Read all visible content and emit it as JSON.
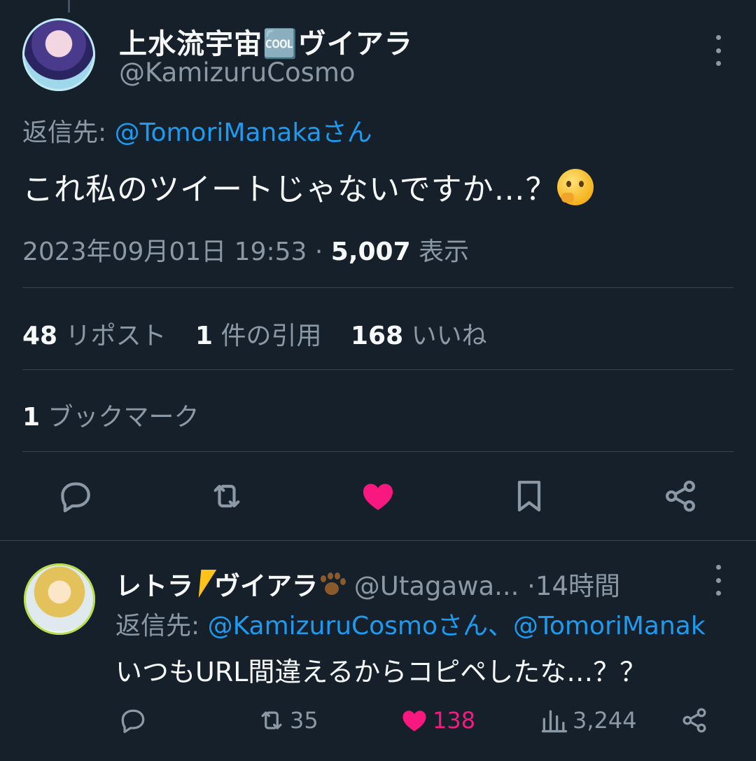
{
  "main_tweet": {
    "display_name": "上水流宇宙🆒ヴイアラ",
    "handle": "@KamizuruCosmo",
    "reply_to_prefix": "返信先: ",
    "reply_to_handle": "@TomoriManakaさん",
    "text": "これ私のツイートじゃないですか…？",
    "emoji": "thinking-face",
    "timestamp": "2023年09月01日 19:53",
    "separator": " · ",
    "views_count": "5,007",
    "views_label": " 表示",
    "stats": [
      {
        "count": "48",
        "label": " リポスト"
      },
      {
        "count": "1",
        "label": " 件の引用"
      },
      {
        "count": "168",
        "label": " いいね"
      }
    ],
    "bookmarks_count": "1",
    "bookmarks_label": " ブックマーク"
  },
  "reply_tweet": {
    "display_name_a": "レトラ",
    "display_name_b": "ヴイアラ",
    "handle": "@Utagawa...",
    "time": " ·14時間",
    "reply_to_prefix": "返信先: ",
    "reply_to_handles": "@KamizuruCosmoさん、@TomoriManak",
    "text": "いつもURL間違えるからコピペしたな…？？",
    "retweets": "35",
    "likes": "138",
    "views": "3,244"
  },
  "colors": {
    "background": "#15202b",
    "text": "#f7f9f9",
    "muted": "#8b98a5",
    "link": "#1d9bf0",
    "like": "#f91880",
    "divider": "#38444d"
  }
}
